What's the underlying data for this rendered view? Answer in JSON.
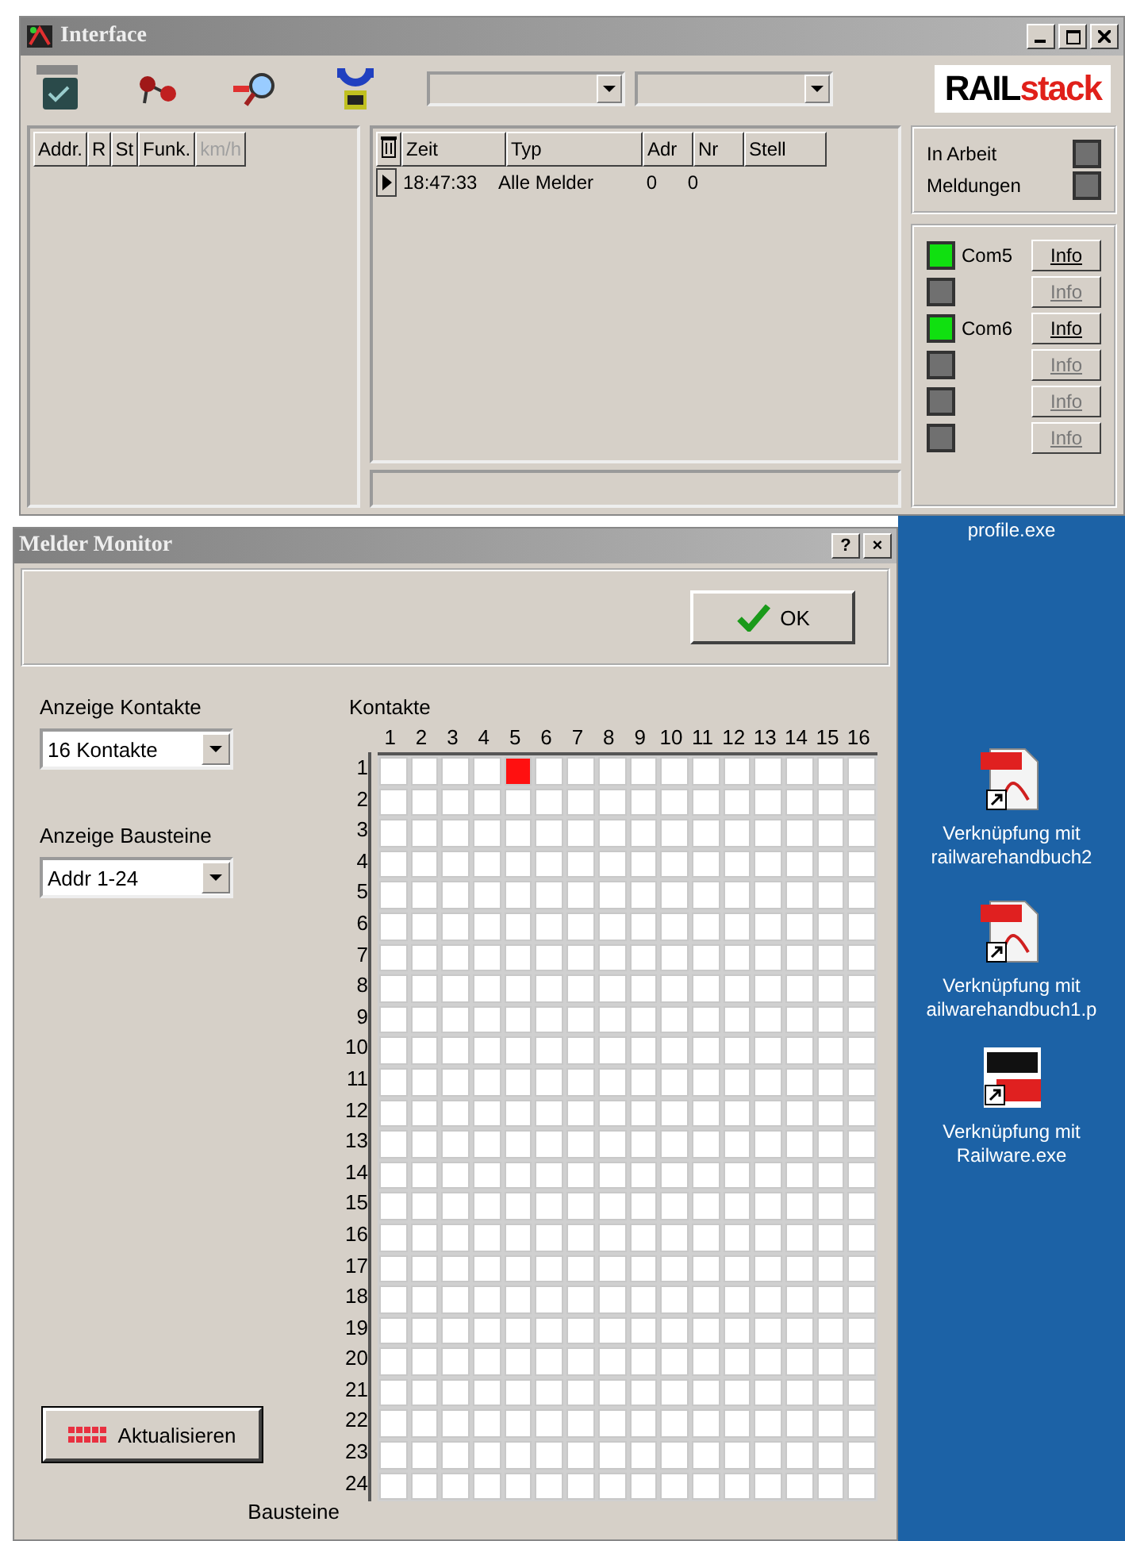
{
  "interface_window": {
    "title": "Interface",
    "logo": "RAILstack",
    "toolbar_dropdowns": [
      {
        "kind": "combo"
      },
      {
        "kind": "combo"
      }
    ],
    "loco_table": {
      "columns": [
        {
          "label": "Addr.",
          "disabled": false
        },
        {
          "label": "R",
          "disabled": false
        },
        {
          "label": "St",
          "disabled": false
        },
        {
          "label": "Funk.",
          "disabled": false
        },
        {
          "label": "km/h",
          "disabled": true
        }
      ]
    },
    "event_table": {
      "columns": [
        "Zeit",
        "Typ",
        "Adr",
        "Nr",
        "Stell"
      ],
      "rows": [
        {
          "selected": true,
          "cells": [
            "18:47:33",
            "Alle Melder",
            "0",
            "0",
            ""
          ]
        }
      ]
    },
    "status_leds": [
      {
        "label": "In Arbeit",
        "on": false
      },
      {
        "label": "Meldungen",
        "on": false
      }
    ],
    "ports": [
      {
        "label": "Com5",
        "on": true,
        "button": "Info",
        "disabled": false
      },
      {
        "on": false,
        "button": "Info",
        "disabled": true
      },
      {
        "label": "Com6",
        "on": true,
        "button": "Info",
        "disabled": false
      },
      {
        "on": false,
        "button": "Info",
        "disabled": true
      },
      {
        "on": false,
        "button": "Info",
        "disabled": true
      },
      {
        "on": false,
        "button": "Info",
        "disabled": true
      }
    ]
  },
  "melder_monitor": {
    "title": "Melder Monitor",
    "help_button": "?",
    "close_button": "×",
    "ok_button": "OK",
    "contacts_label": "Anzeige Kontakte",
    "contacts_select": "16 Kontakte",
    "modules_label": "Anzeige Bausteine",
    "modules_select": "Addr 1-24",
    "refresh_button": "Aktualisieren",
    "grid_title": "Kontakte",
    "grid_row_title": "Bausteine",
    "columns": [
      "1",
      "2",
      "3",
      "4",
      "5",
      "6",
      "7",
      "8",
      "9",
      "10",
      "11",
      "12",
      "13",
      "14",
      "15",
      "16"
    ],
    "rows": [
      {
        "label": "1",
        "on": [
          false,
          false,
          false,
          false,
          true,
          false,
          false,
          false,
          false,
          false,
          false,
          false,
          false,
          false,
          false,
          false
        ]
      },
      {
        "label": "2",
        "on": [
          false,
          false,
          false,
          false,
          false,
          false,
          false,
          false,
          false,
          false,
          false,
          false,
          false,
          false,
          false,
          false
        ]
      },
      {
        "label": "3",
        "on": [
          false,
          false,
          false,
          false,
          false,
          false,
          false,
          false,
          false,
          false,
          false,
          false,
          false,
          false,
          false,
          false
        ]
      },
      {
        "label": "4",
        "on": [
          false,
          false,
          false,
          false,
          false,
          false,
          false,
          false,
          false,
          false,
          false,
          false,
          false,
          false,
          false,
          false
        ]
      },
      {
        "label": "5",
        "on": [
          false,
          false,
          false,
          false,
          false,
          false,
          false,
          false,
          false,
          false,
          false,
          false,
          false,
          false,
          false,
          false
        ]
      },
      {
        "label": "6",
        "on": [
          false,
          false,
          false,
          false,
          false,
          false,
          false,
          false,
          false,
          false,
          false,
          false,
          false,
          false,
          false,
          false
        ]
      },
      {
        "label": "7",
        "on": [
          false,
          false,
          false,
          false,
          false,
          false,
          false,
          false,
          false,
          false,
          false,
          false,
          false,
          false,
          false,
          false
        ]
      },
      {
        "label": "8",
        "on": [
          false,
          false,
          false,
          false,
          false,
          false,
          false,
          false,
          false,
          false,
          false,
          false,
          false,
          false,
          false,
          false
        ]
      },
      {
        "label": "9",
        "on": [
          false,
          false,
          false,
          false,
          false,
          false,
          false,
          false,
          false,
          false,
          false,
          false,
          false,
          false,
          false,
          false
        ]
      },
      {
        "label": "10",
        "on": [
          false,
          false,
          false,
          false,
          false,
          false,
          false,
          false,
          false,
          false,
          false,
          false,
          false,
          false,
          false,
          false
        ]
      },
      {
        "label": "11",
        "on": [
          false,
          false,
          false,
          false,
          false,
          false,
          false,
          false,
          false,
          false,
          false,
          false,
          false,
          false,
          false,
          false
        ]
      },
      {
        "label": "12",
        "on": [
          false,
          false,
          false,
          false,
          false,
          false,
          false,
          false,
          false,
          false,
          false,
          false,
          false,
          false,
          false,
          false
        ]
      },
      {
        "label": "13",
        "on": [
          false,
          false,
          false,
          false,
          false,
          false,
          false,
          false,
          false,
          false,
          false,
          false,
          false,
          false,
          false,
          false
        ]
      },
      {
        "label": "14",
        "on": [
          false,
          false,
          false,
          false,
          false,
          false,
          false,
          false,
          false,
          false,
          false,
          false,
          false,
          false,
          false,
          false
        ]
      },
      {
        "label": "15",
        "on": [
          false,
          false,
          false,
          false,
          false,
          false,
          false,
          false,
          false,
          false,
          false,
          false,
          false,
          false,
          false,
          false
        ]
      },
      {
        "label": "16",
        "on": [
          false,
          false,
          false,
          false,
          false,
          false,
          false,
          false,
          false,
          false,
          false,
          false,
          false,
          false,
          false,
          false
        ]
      },
      {
        "label": "17",
        "on": [
          false,
          false,
          false,
          false,
          false,
          false,
          false,
          false,
          false,
          false,
          false,
          false,
          false,
          false,
          false,
          false
        ]
      },
      {
        "label": "18",
        "on": [
          false,
          false,
          false,
          false,
          false,
          false,
          false,
          false,
          false,
          false,
          false,
          false,
          false,
          false,
          false,
          false
        ]
      },
      {
        "label": "19",
        "on": [
          false,
          false,
          false,
          false,
          false,
          false,
          false,
          false,
          false,
          false,
          false,
          false,
          false,
          false,
          false,
          false
        ]
      },
      {
        "label": "20",
        "on": [
          false,
          false,
          false,
          false,
          false,
          false,
          false,
          false,
          false,
          false,
          false,
          false,
          false,
          false,
          false,
          false
        ]
      },
      {
        "label": "21",
        "on": [
          false,
          false,
          false,
          false,
          false,
          false,
          false,
          false,
          false,
          false,
          false,
          false,
          false,
          false,
          false,
          false
        ]
      },
      {
        "label": "22",
        "on": [
          false,
          false,
          false,
          false,
          false,
          false,
          false,
          false,
          false,
          false,
          false,
          false,
          false,
          false,
          false,
          false
        ]
      },
      {
        "label": "23",
        "on": [
          false,
          false,
          false,
          false,
          false,
          false,
          false,
          false,
          false,
          false,
          false,
          false,
          false,
          false,
          false,
          false
        ]
      },
      {
        "label": "24",
        "on": [
          false,
          false,
          false,
          false,
          false,
          false,
          false,
          false,
          false,
          false,
          false,
          false,
          false,
          false,
          false,
          false
        ]
      }
    ]
  },
  "desktop_icons": [
    {
      "kind": "none",
      "lines": [
        "profile.exe"
      ]
    },
    {
      "kind": "pdf",
      "lines": [
        "Verknüpfung mit",
        "railwarehandbuch2"
      ]
    },
    {
      "kind": "pdf",
      "lines": [
        "Verknüpfung mit",
        "ailwarehandbuch1.p"
      ]
    },
    {
      "kind": "app",
      "lines": [
        "Verknüpfung mit",
        "Railware.exe"
      ]
    }
  ]
}
